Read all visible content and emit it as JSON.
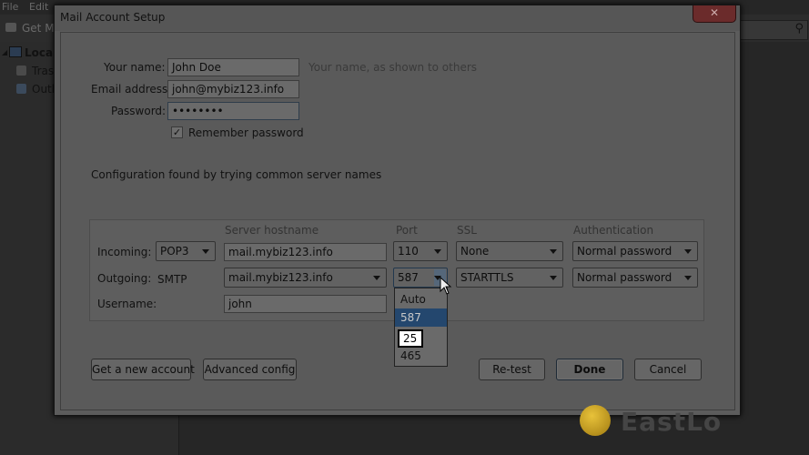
{
  "bg_app": {
    "menu": [
      "File",
      "Edit"
    ],
    "toolbar_get_mail": "Get M",
    "sidebar_items": [
      "Local",
      "Tras",
      "Outl"
    ]
  },
  "dialog": {
    "title": "Mail Account Setup",
    "name_label": "Your name:",
    "name_value": "John Doe",
    "name_hint": "Your name, as shown to others",
    "email_label": "Email address:",
    "email_value": "john@mybiz123.info",
    "password_label": "Password:",
    "password_value": "••••••••",
    "remember_label": "Remember password",
    "remember_checked": true,
    "config_message": "Configuration found by trying common server names"
  },
  "servers": {
    "headers": {
      "hostname": "Server hostname",
      "port": "Port",
      "ssl": "SSL",
      "auth": "Authentication"
    },
    "incoming": {
      "label": "Incoming:",
      "protocol": "POP3",
      "hostname": "mail.mybiz123.info",
      "port": "110",
      "ssl": "None",
      "auth": "Normal password"
    },
    "outgoing": {
      "label": "Outgoing:",
      "protocol": "SMTP",
      "hostname": "mail.mybiz123.info",
      "port": "587",
      "ssl": "STARTTLS",
      "auth": "Normal password"
    },
    "username_label": "Username:",
    "username_value": "john"
  },
  "port_dropdown": {
    "options": [
      "Auto",
      "587",
      "25",
      "465"
    ],
    "selected": "587"
  },
  "buttons": {
    "new_account": "Get a new account",
    "advanced": "Advanced config",
    "retest": "Re-test",
    "done": "Done",
    "cancel": "Cancel"
  },
  "watermark": "EastLo"
}
